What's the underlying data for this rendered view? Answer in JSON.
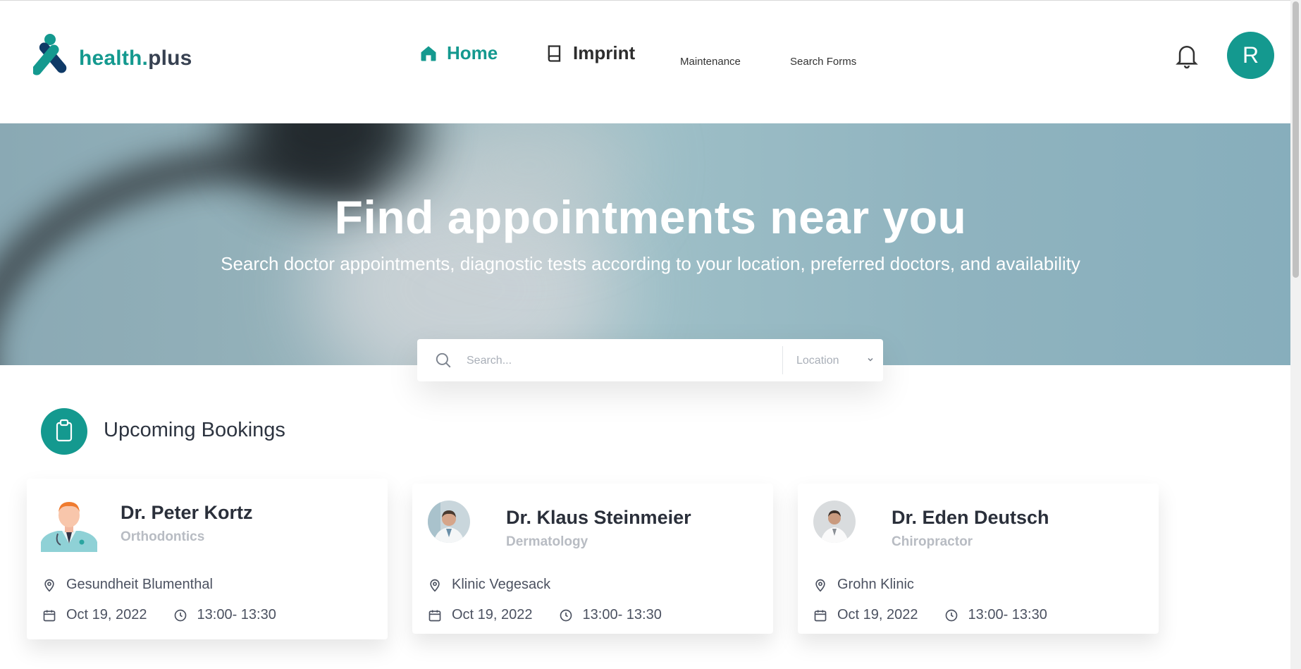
{
  "brand": {
    "part1": "health.",
    "part2": "plus"
  },
  "nav": {
    "home": "Home",
    "imprint": "Imprint",
    "maintenance": "Maintenance",
    "search_forms": "Search Forms"
  },
  "user": {
    "initial": "R"
  },
  "hero": {
    "title": "Find appointments near you",
    "subtitle": "Search doctor appointments, diagnostic tests according to your location, preferred doctors, and availability"
  },
  "search": {
    "placeholder": "Search...",
    "location_label": "Location"
  },
  "upcoming": {
    "title": "Upcoming Bookings",
    "bookings": [
      {
        "doctor": "Dr. Peter Kortz",
        "specialty": "Orthodontics",
        "location": "Gesundheit Blumenthal",
        "date": "Oct 19, 2022",
        "time": "13:00- 13:30"
      },
      {
        "doctor": "Dr. Klaus Steinmeier",
        "specialty": "Dermatology",
        "location": "Klinic Vegesack",
        "date": "Oct 19, 2022",
        "time": "13:00- 13:30"
      },
      {
        "doctor": "Dr. Eden Deutsch",
        "specialty": "Chiropractor",
        "location": "Grohn Klinic",
        "date": "Oct 19, 2022",
        "time": "13:00- 13:30"
      }
    ]
  },
  "colors": {
    "brand": "#14998f",
    "text_dark": "#2a2f3a",
    "muted": "#b8bcc3"
  },
  "icons": [
    "logo-icon",
    "home-icon",
    "book-icon",
    "bell-icon",
    "search-icon",
    "chevron-down-icon",
    "clipboard-icon",
    "map-pin-icon",
    "calendar-icon",
    "clock-icon"
  ]
}
